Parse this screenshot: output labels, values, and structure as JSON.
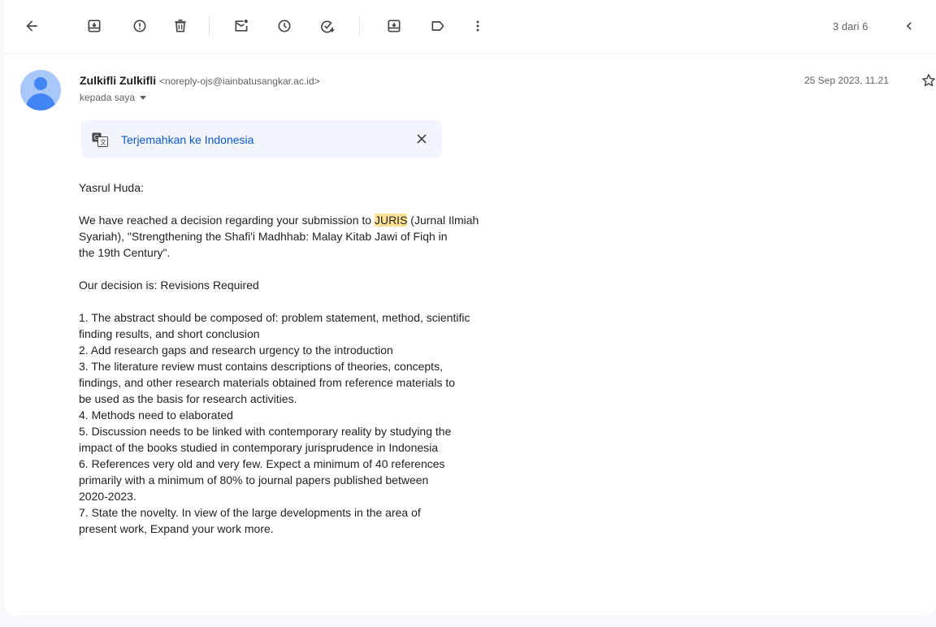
{
  "toolbar": {
    "icons": [
      "back-arrow-icon",
      "archive-icon",
      "report-spam-icon",
      "delete-icon",
      "mark-unread-icon",
      "snooze-icon",
      "add-to-tasks-icon",
      "move-to-icon",
      "label-icon",
      "more-vert-icon",
      "prev-chevron-icon"
    ],
    "pager_text": "3 dari 6"
  },
  "message": {
    "sender_name": "Zulkifli Zulkifli",
    "sender_email": "<noreply-ojs@iainbatusangkar.ac.id>",
    "recipient_label": "kepada saya",
    "date": "25 Sep 2023, 11.21"
  },
  "translate": {
    "label": "Terjemahkan ke Indonesia"
  },
  "body": {
    "greeting": "Yasrul Huda:",
    "para1_before": "We have reached a decision regarding your submission to ",
    "para1_highlight": "JURIS",
    "para1_after_l1": " (Jurnal Ilmiah",
    "para1_l2": "Syariah), \"Strengthening the Shafi'i Madhhab: Malay Kitab Jawi of Fiqh in",
    "para1_l3": "the 19th Century\".",
    "decision": "Our decision is: Revisions Required",
    "lines": [
      "1. The abstract should be composed of: problem statement, method, scientific",
      "finding results, and short conclusion",
      "2. Add research gaps and research urgency to the introduction",
      "3. The literature review must contains descriptions of theories, concepts,",
      "findings, and other research materials obtained from reference materials to",
      "be used as the basis for research activities.",
      "4. Methods need to elaborated",
      "5. Discussion needs to be linked with contemporary reality by studying the",
      "impact of the books studied in contemporary jurisprudence in Indonesia",
      "6. References very old and very few. Expect a minimum of 40 references",
      "primarily with a minimum of 80% to journal papers published between",
      "2020-2023.",
      "7. State the novelty. In view of the large developments in the area of",
      "present work, Expand your work more."
    ]
  }
}
